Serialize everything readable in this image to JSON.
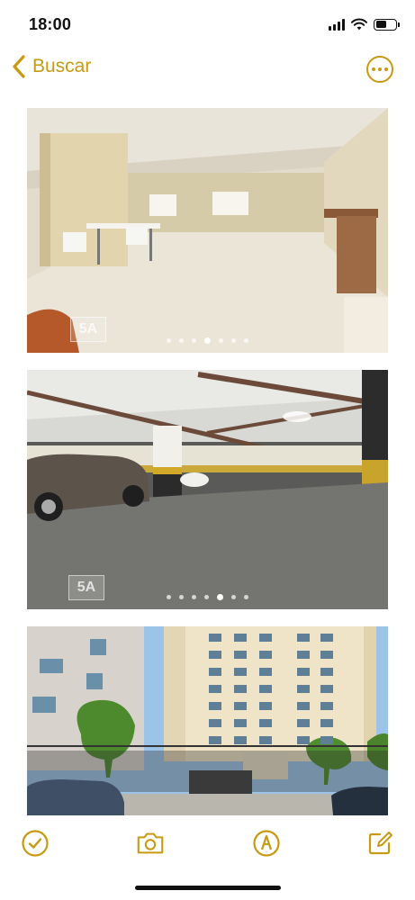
{
  "status_bar": {
    "time": "18:00",
    "icons": [
      "cellular-signal-icon",
      "wifi-icon",
      "battery-icon"
    ]
  },
  "nav": {
    "back_label": "Buscar",
    "back_icon": "chevron-left-icon",
    "more_icon": "ellipsis-circle-icon"
  },
  "accent_color": "#c79a12",
  "photos": [
    {
      "description": "salao-de-festas",
      "watermark": "5A",
      "dot_count": 7,
      "active_dot": 3
    },
    {
      "description": "garagem",
      "watermark": "5A",
      "dot_count": 7,
      "active_dot": 4
    },
    {
      "description": "fachada-predio"
    }
  ],
  "toolbar": {
    "icons": [
      "checkmark-circle-icon",
      "camera-icon",
      "compose-pen-circle-icon",
      "edit-note-icon"
    ]
  }
}
